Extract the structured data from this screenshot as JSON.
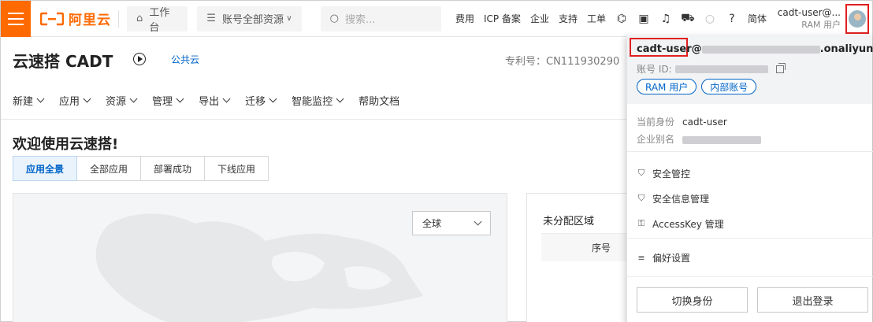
{
  "brand": {
    "logo_text": "阿里云",
    "accent": "#ff6a00",
    "link": "#0064c8",
    "alert": "#e02020"
  },
  "topbar": {
    "workbench": "工作台",
    "resource_scope": "账号全部资源",
    "search_placeholder": "搜索...",
    "nav": [
      "费用",
      "ICP 备案",
      "企业",
      "支持",
      "工单"
    ],
    "icons": [
      "code-icon",
      "terminal-icon",
      "bell-icon",
      "cart-icon",
      "bulb-icon",
      "help-icon"
    ],
    "language": "简体",
    "user_name": "cadt-user@...",
    "user_role": "RAM 用户"
  },
  "page": {
    "product_title": "云速搭 CADT",
    "cloud_type": "公共云",
    "patent": "专利号：CN111930290",
    "menu": [
      "新建",
      "应用",
      "资源",
      "管理",
      "导出",
      "迁移",
      "智能监控",
      "帮助文档"
    ],
    "menu_has_chevron": [
      true,
      true,
      true,
      true,
      true,
      true,
      true,
      false
    ]
  },
  "main": {
    "welcome": "欢迎使用云速搭!",
    "tabs": [
      "应用全景",
      "全部应用",
      "部署成功",
      "下线应用"
    ],
    "active_tab": 0,
    "region_select": "全球",
    "unassigned_title": "未分配区域",
    "seq_header": "序号"
  },
  "dropdown": {
    "email_prefix": "cadt-user",
    "email_suffix": "onaliyun.com",
    "account_id_label": "账号 ID:",
    "badges": [
      "RAM 用户",
      "内部账号"
    ],
    "identity_label": "当前身份",
    "identity_value": "cadt-user",
    "alias_label": "企业别名",
    "menu": [
      {
        "icon": "shield-icon",
        "label": "安全管控"
      },
      {
        "icon": "shield-info-icon",
        "label": "安全信息管理"
      },
      {
        "icon": "key-icon",
        "label": "AccessKey 管理"
      }
    ],
    "preferences": "偏好设置",
    "switch_identity": "切换身份",
    "logout": "退出登录"
  }
}
